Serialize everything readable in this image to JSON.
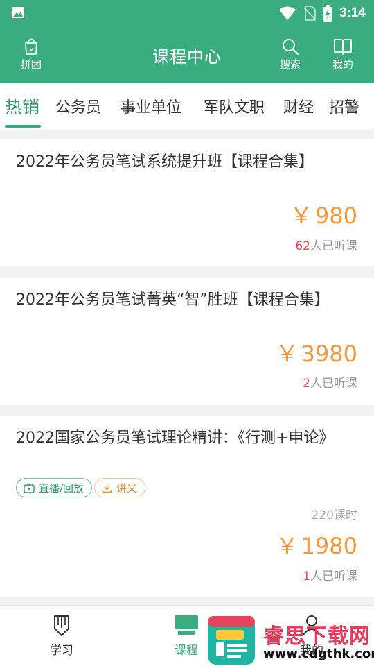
{
  "status_bar": {
    "time": "3:14"
  },
  "header": {
    "title": "课程中心",
    "left_button": {
      "label": "拼团",
      "icon": "bag-icon"
    },
    "search_button": {
      "label": "搜索",
      "icon": "search-icon"
    },
    "mine_button": {
      "label": "我的",
      "icon": "book-icon"
    }
  },
  "tabs": [
    "热销",
    "公务员",
    "事业单位",
    "军队文职",
    "财经",
    "招警"
  ],
  "courses": [
    {
      "title": "2022年公务员笔试系统提升班【课程合集】",
      "currency": "￥",
      "price": "980",
      "listeners": "62",
      "listen_suffix": "人已听课"
    },
    {
      "title": "2022年公务员笔试菁英“智”胜班【课程合集】",
      "currency": "￥",
      "price": "3980",
      "listeners": "2",
      "listen_suffix": "人已听课"
    },
    {
      "title": "2022国家公务员笔试理论精讲：《行测+申论》",
      "badges": [
        "直播/回放",
        "讲义"
      ],
      "hours": "220课时",
      "currency": "￥",
      "price": "1980",
      "listeners": "1",
      "listen_suffix": "人已听课"
    }
  ],
  "bottom_nav": [
    {
      "label": "学习",
      "icon": "pen-icon"
    },
    {
      "label": "课程",
      "icon": "monitor-icon"
    },
    {
      "label": "我的",
      "icon": "person-icon"
    }
  ],
  "watermark": {
    "title": "睿思下载网",
    "url": "www.cdgthk.com"
  },
  "colors": {
    "primary": "#3aac80",
    "price": "#f59a3c",
    "listeners_count": "#e64848"
  }
}
